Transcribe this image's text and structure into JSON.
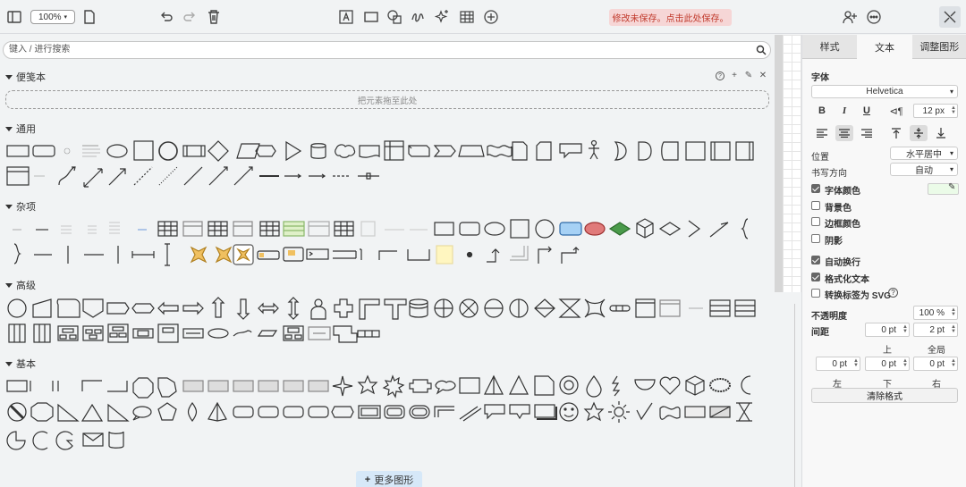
{
  "toolbar": {
    "zoom": "100%",
    "unsaved_notice": "修改未保存。点击此处保存。",
    "icons": [
      "sidebar-toggle-icon",
      "page-icon",
      "undo-icon",
      "redo-icon",
      "delete-icon",
      "text-icon",
      "rectangle-icon",
      "shapes-icon",
      "freehand-icon",
      "sparkle-icon",
      "table-icon",
      "insert-icon",
      "share-user-icon",
      "more-icon",
      "format-panel-icon"
    ]
  },
  "search": {
    "placeholder": "键入 / 进行搜索"
  },
  "sections": {
    "scratchpad": "便笺本",
    "scratchpad_drop": "把元素拖至此处",
    "general": "通用",
    "misc": "杂项",
    "advanced": "高级",
    "basic": "基本"
  },
  "more_shapes": "更多图形",
  "format": {
    "tabs": [
      "样式",
      "文本",
      "调整图形"
    ],
    "font_label": "字体",
    "font_family": "Helvetica",
    "font_size": "12 px",
    "position_label": "位置",
    "position_value": "水平居中",
    "writing_dir_label": "书写方向",
    "writing_dir_value": "自动",
    "font_color": "字体颜色",
    "bg_color": "背景色",
    "border_color": "边框颜色",
    "shadow": "阴影",
    "wrap": "自动换行",
    "formatted_text": "格式化文本",
    "label_svg": "转换标签为 SVG",
    "opacity_label": "不透明度",
    "opacity_value": "100 %",
    "spacing_label": "间距",
    "spacing_top": "0 pt",
    "spacing_global": "2 pt",
    "spacing_left": "0 pt",
    "spacing_bottom": "0 pt",
    "spacing_right": "0 pt",
    "lbl_top": "上",
    "lbl_global": "全局",
    "lbl_left": "左",
    "lbl_bottom": "下",
    "lbl_right": "右",
    "clear_format": "清除格式"
  },
  "colors": {
    "accent": "#1a73e8",
    "unsaved_bg": "#f6d6d6",
    "unsaved_text": "#c0392b",
    "font_color_swatch": "#ebfbe8"
  }
}
